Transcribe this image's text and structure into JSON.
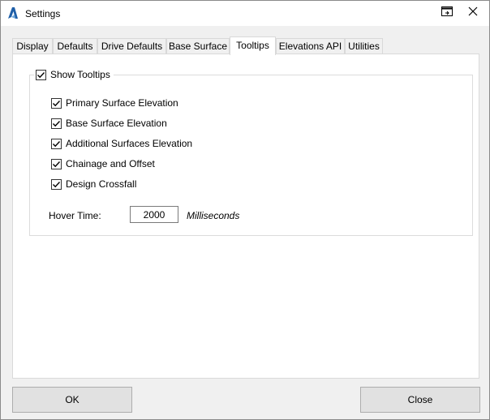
{
  "window": {
    "title": "Settings",
    "app_icon": "autodesk-a-icon",
    "restore_icon": "restore-window-icon",
    "close_icon": "close-icon"
  },
  "tabs": [
    {
      "label": "Display"
    },
    {
      "label": "Defaults"
    },
    {
      "label": "Drive Defaults"
    },
    {
      "label": "Base Surface"
    },
    {
      "label": "Tooltips",
      "active": true
    },
    {
      "label": "Elevations API"
    },
    {
      "label": "Utilities"
    }
  ],
  "tooltips": {
    "show_tooltips_label": "Show Tooltips",
    "show_tooltips_checked": true,
    "options": [
      {
        "label": "Primary Surface Elevation",
        "checked": true
      },
      {
        "label": "Base Surface Elevation",
        "checked": true
      },
      {
        "label": "Additional Surfaces Elevation",
        "checked": true
      },
      {
        "label": "Chainage and Offset",
        "checked": true
      },
      {
        "label": "Design Crossfall",
        "checked": true
      }
    ],
    "hover_time_label": "Hover Time:",
    "hover_time_value": "2000",
    "hover_time_unit": "Milliseconds"
  },
  "footer": {
    "ok_label": "OK",
    "close_label": "Close"
  },
  "colors": {
    "dialog_bg": "#f0f0f0",
    "panel_bg": "#ffffff",
    "button_bg": "#e1e1e1",
    "app_icon_blue": "#1f5fa8"
  }
}
